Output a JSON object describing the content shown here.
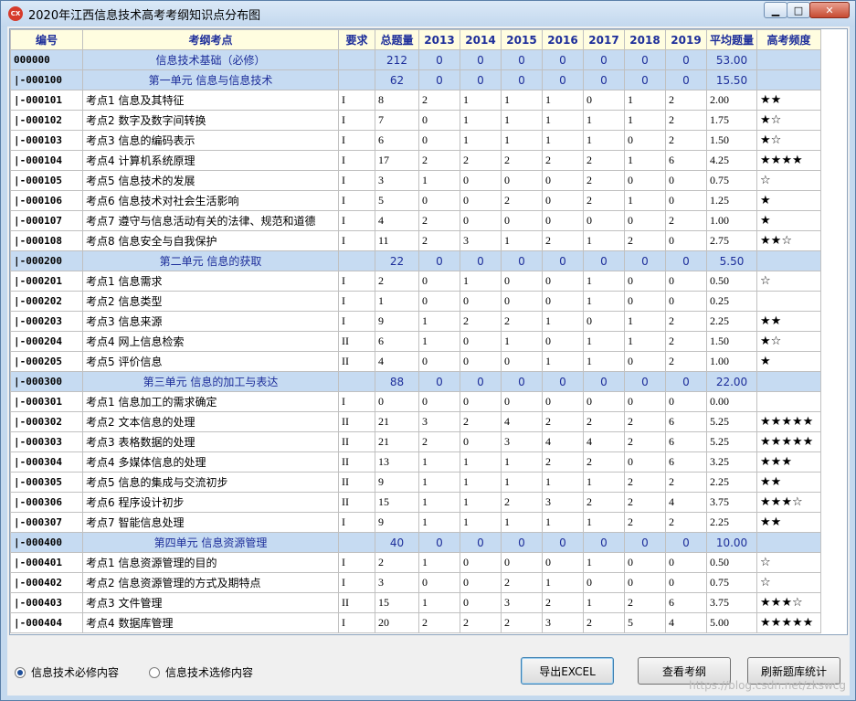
{
  "window": {
    "title": "2020年江西信息技术高考考纲知识点分布图",
    "icon_text": "CX",
    "minimize": "▁",
    "maximize": "□",
    "close": "✕"
  },
  "columns": [
    "编号",
    "考纲考点",
    "要求",
    "总题量",
    "2013",
    "2014",
    "2015",
    "2016",
    "2017",
    "2018",
    "2019",
    "平均题量",
    "高考频度"
  ],
  "rows": [
    {
      "type": "section",
      "code": "000000",
      "topic": "信息技术基础（必修）",
      "req": "",
      "total": "212",
      "y2013": "0",
      "y2014": "0",
      "y2015": "0",
      "y2016": "0",
      "y2017": "0",
      "y2018": "0",
      "y2019": "0",
      "avg": "53.00",
      "freq": ""
    },
    {
      "type": "section",
      "code": "|-000100",
      "topic": "第一单元 信息与信息技术",
      "req": "",
      "total": "62",
      "y2013": "0",
      "y2014": "0",
      "y2015": "0",
      "y2016": "0",
      "y2017": "0",
      "y2018": "0",
      "y2019": "0",
      "avg": "15.50",
      "freq": ""
    },
    {
      "type": "item",
      "code": "|-000101",
      "topic": "考点1 信息及其特征",
      "req": "I",
      "total": "8",
      "y2013": "2",
      "y2014": "1",
      "y2015": "1",
      "y2016": "1",
      "y2017": "0",
      "y2018": "1",
      "y2019": "2",
      "avg": "2.00",
      "freq": "★★"
    },
    {
      "type": "item",
      "code": "|-000102",
      "topic": "考点2 数字及数字间转换",
      "req": "I",
      "total": "7",
      "y2013": "0",
      "y2014": "1",
      "y2015": "1",
      "y2016": "1",
      "y2017": "1",
      "y2018": "1",
      "y2019": "2",
      "avg": "1.75",
      "freq": "★☆"
    },
    {
      "type": "item",
      "code": "|-000103",
      "topic": "考点3 信息的编码表示",
      "req": "I",
      "total": "6",
      "y2013": "0",
      "y2014": "1",
      "y2015": "1",
      "y2016": "1",
      "y2017": "1",
      "y2018": "0",
      "y2019": "2",
      "avg": "1.50",
      "freq": "★☆"
    },
    {
      "type": "item",
      "code": "|-000104",
      "topic": "考点4 计算机系统原理",
      "req": "I",
      "total": "17",
      "y2013": "2",
      "y2014": "2",
      "y2015": "2",
      "y2016": "2",
      "y2017": "2",
      "y2018": "1",
      "y2019": "6",
      "avg": "4.25",
      "freq": "★★★★"
    },
    {
      "type": "item",
      "code": "|-000105",
      "topic": "考点5 信息技术的发展",
      "req": "I",
      "total": "3",
      "y2013": "1",
      "y2014": "0",
      "y2015": "0",
      "y2016": "0",
      "y2017": "2",
      "y2018": "0",
      "y2019": "0",
      "avg": "0.75",
      "freq": "☆"
    },
    {
      "type": "item",
      "code": "|-000106",
      "topic": "考点6 信息技术对社会生活影响",
      "req": "I",
      "total": "5",
      "y2013": "0",
      "y2014": "0",
      "y2015": "2",
      "y2016": "0",
      "y2017": "2",
      "y2018": "1",
      "y2019": "0",
      "avg": "1.25",
      "freq": "★"
    },
    {
      "type": "item",
      "code": "|-000107",
      "topic": "考点7 遵守与信息活动有关的法律、规范和道德",
      "req": "I",
      "total": "4",
      "y2013": "2",
      "y2014": "0",
      "y2015": "0",
      "y2016": "0",
      "y2017": "0",
      "y2018": "0",
      "y2019": "2",
      "avg": "1.00",
      "freq": "★"
    },
    {
      "type": "item",
      "code": "|-000108",
      "topic": "考点8 信息安全与自我保护",
      "req": "I",
      "total": "11",
      "y2013": "2",
      "y2014": "3",
      "y2015": "1",
      "y2016": "2",
      "y2017": "1",
      "y2018": "2",
      "y2019": "0",
      "avg": "2.75",
      "freq": "★★☆"
    },
    {
      "type": "section",
      "code": "|-000200",
      "topic": "第二单元 信息的获取",
      "req": "",
      "total": "22",
      "y2013": "0",
      "y2014": "0",
      "y2015": "0",
      "y2016": "0",
      "y2017": "0",
      "y2018": "0",
      "y2019": "0",
      "avg": "5.50",
      "freq": ""
    },
    {
      "type": "item",
      "code": "|-000201",
      "topic": "考点1 信息需求",
      "req": "I",
      "total": "2",
      "y2013": "0",
      "y2014": "1",
      "y2015": "0",
      "y2016": "0",
      "y2017": "1",
      "y2018": "0",
      "y2019": "0",
      "avg": "0.50",
      "freq": "☆"
    },
    {
      "type": "item",
      "code": "|-000202",
      "topic": "考点2 信息类型",
      "req": "I",
      "total": "1",
      "y2013": "0",
      "y2014": "0",
      "y2015": "0",
      "y2016": "0",
      "y2017": "1",
      "y2018": "0",
      "y2019": "0",
      "avg": "0.25",
      "freq": ""
    },
    {
      "type": "item",
      "code": "|-000203",
      "topic": "考点3 信息来源",
      "req": "I",
      "total": "9",
      "y2013": "1",
      "y2014": "2",
      "y2015": "2",
      "y2016": "1",
      "y2017": "0",
      "y2018": "1",
      "y2019": "2",
      "avg": "2.25",
      "freq": "★★"
    },
    {
      "type": "item",
      "code": "|-000204",
      "topic": "考点4 网上信息检索",
      "req": "II",
      "total": "6",
      "y2013": "1",
      "y2014": "0",
      "y2015": "1",
      "y2016": "0",
      "y2017": "1",
      "y2018": "1",
      "y2019": "2",
      "avg": "1.50",
      "freq": "★☆"
    },
    {
      "type": "item",
      "code": "|-000205",
      "topic": "考点5 评价信息",
      "req": "II",
      "total": "4",
      "y2013": "0",
      "y2014": "0",
      "y2015": "0",
      "y2016": "1",
      "y2017": "1",
      "y2018": "0",
      "y2019": "2",
      "avg": "1.00",
      "freq": "★"
    },
    {
      "type": "section",
      "code": "|-000300",
      "topic": "第三单元 信息的加工与表达",
      "req": "",
      "total": "88",
      "y2013": "0",
      "y2014": "0",
      "y2015": "0",
      "y2016": "0",
      "y2017": "0",
      "y2018": "0",
      "y2019": "0",
      "avg": "22.00",
      "freq": ""
    },
    {
      "type": "item",
      "code": "|-000301",
      "topic": "考点1 信息加工的需求确定",
      "req": "I",
      "total": "0",
      "y2013": "0",
      "y2014": "0",
      "y2015": "0",
      "y2016": "0",
      "y2017": "0",
      "y2018": "0",
      "y2019": "0",
      "avg": "0.00",
      "freq": ""
    },
    {
      "type": "item",
      "code": "|-000302",
      "topic": "考点2 文本信息的处理",
      "req": "II",
      "total": "21",
      "y2013": "3",
      "y2014": "2",
      "y2015": "4",
      "y2016": "2",
      "y2017": "2",
      "y2018": "2",
      "y2019": "6",
      "avg": "5.25",
      "freq": "★★★★★"
    },
    {
      "type": "item",
      "code": "|-000303",
      "topic": "考点3 表格数据的处理",
      "req": "II",
      "total": "21",
      "y2013": "2",
      "y2014": "0",
      "y2015": "3",
      "y2016": "4",
      "y2017": "4",
      "y2018": "2",
      "y2019": "6",
      "avg": "5.25",
      "freq": "★★★★★"
    },
    {
      "type": "item",
      "code": "|-000304",
      "topic": "考点4 多媒体信息的处理",
      "req": "II",
      "total": "13",
      "y2013": "1",
      "y2014": "1",
      "y2015": "1",
      "y2016": "2",
      "y2017": "2",
      "y2018": "0",
      "y2019": "6",
      "avg": "3.25",
      "freq": "★★★"
    },
    {
      "type": "item",
      "code": "|-000305",
      "topic": "考点5 信息的集成与交流初步",
      "req": "II",
      "total": "9",
      "y2013": "1",
      "y2014": "1",
      "y2015": "1",
      "y2016": "1",
      "y2017": "1",
      "y2018": "2",
      "y2019": "2",
      "avg": "2.25",
      "freq": "★★"
    },
    {
      "type": "item",
      "code": "|-000306",
      "topic": "考点6 程序设计初步",
      "req": "II",
      "total": "15",
      "y2013": "1",
      "y2014": "1",
      "y2015": "2",
      "y2016": "3",
      "y2017": "2",
      "y2018": "2",
      "y2019": "4",
      "avg": "3.75",
      "freq": "★★★☆"
    },
    {
      "type": "item",
      "code": "|-000307",
      "topic": "考点7 智能信息处理",
      "req": "I",
      "total": "9",
      "y2013": "1",
      "y2014": "1",
      "y2015": "1",
      "y2016": "1",
      "y2017": "1",
      "y2018": "2",
      "y2019": "2",
      "avg": "2.25",
      "freq": "★★"
    },
    {
      "type": "section",
      "code": "|-000400",
      "topic": "第四单元 信息资源管理",
      "req": "",
      "total": "40",
      "y2013": "0",
      "y2014": "0",
      "y2015": "0",
      "y2016": "0",
      "y2017": "0",
      "y2018": "0",
      "y2019": "0",
      "avg": "10.00",
      "freq": ""
    },
    {
      "type": "item",
      "code": "|-000401",
      "topic": "考点1 信息资源管理的目的",
      "req": "I",
      "total": "2",
      "y2013": "1",
      "y2014": "0",
      "y2015": "0",
      "y2016": "0",
      "y2017": "1",
      "y2018": "0",
      "y2019": "0",
      "avg": "0.50",
      "freq": "☆"
    },
    {
      "type": "item",
      "code": "|-000402",
      "topic": "考点2 信息资源管理的方式及期特点",
      "req": "I",
      "total": "3",
      "y2013": "0",
      "y2014": "0",
      "y2015": "2",
      "y2016": "1",
      "y2017": "0",
      "y2018": "0",
      "y2019": "0",
      "avg": "0.75",
      "freq": "☆"
    },
    {
      "type": "item",
      "code": "|-000403",
      "topic": "考点3 文件管理",
      "req": "II",
      "total": "15",
      "y2013": "1",
      "y2014": "0",
      "y2015": "3",
      "y2016": "2",
      "y2017": "1",
      "y2018": "2",
      "y2019": "6",
      "avg": "3.75",
      "freq": "★★★☆"
    },
    {
      "type": "item",
      "code": "|-000404",
      "topic": "考点4 数据库管理",
      "req": "I",
      "total": "20",
      "y2013": "2",
      "y2014": "2",
      "y2015": "2",
      "y2016": "3",
      "y2017": "2",
      "y2018": "5",
      "y2019": "4",
      "avg": "5.00",
      "freq": "★★★★★"
    }
  ],
  "footer": {
    "radio_required": "信息技术必修内容",
    "radio_elective": "信息技术选修内容",
    "export_button": "导出EXCEL",
    "view_button": "查看考纲",
    "refresh_button": "刷新题库统计",
    "watermark": "https://blog.csdn.net/zkswcg"
  }
}
